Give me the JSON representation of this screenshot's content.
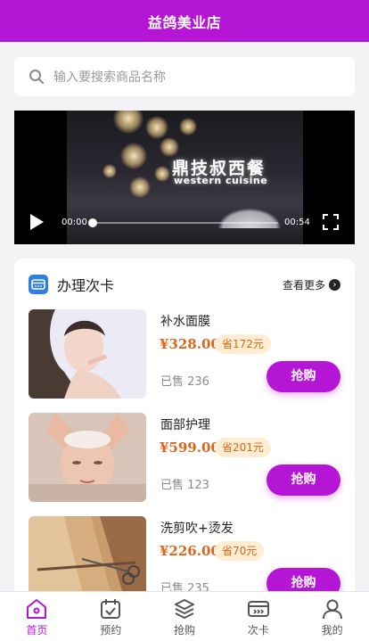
{
  "header": {
    "title": "益鸽美业店"
  },
  "search": {
    "placeholder": "输入要搜索商品名称"
  },
  "video": {
    "sign_cn": "鼎技叔西餐",
    "sign_en": "western cuisine",
    "current_time": "00:00",
    "total_time": "00:54",
    "progress": 0
  },
  "section": {
    "title": "办理次卡",
    "more_label": "查看更多"
  },
  "products": [
    {
      "name": "补水面膜",
      "price": "¥328.00",
      "save": "省172元",
      "sold": "已售 236",
      "buy_label": "抢购"
    },
    {
      "name": "面部护理",
      "price": "¥599.00",
      "save": "省201元",
      "sold": "已售 123",
      "buy_label": "抢购"
    },
    {
      "name": "洗剪吹+烫发",
      "price": "¥226.00",
      "save": "省70元",
      "sold": "已售 235",
      "buy_label": "抢购"
    }
  ],
  "tabbar": {
    "items": [
      {
        "label": "首页",
        "active": true
      },
      {
        "label": "预约",
        "active": false
      },
      {
        "label": "抢购",
        "active": false
      },
      {
        "label": "次卡",
        "active": false
      },
      {
        "label": "我的",
        "active": false
      }
    ]
  },
  "colors": {
    "accent": "#b516d6",
    "price": "#e0651b",
    "save_bg": "#fdeed3"
  }
}
